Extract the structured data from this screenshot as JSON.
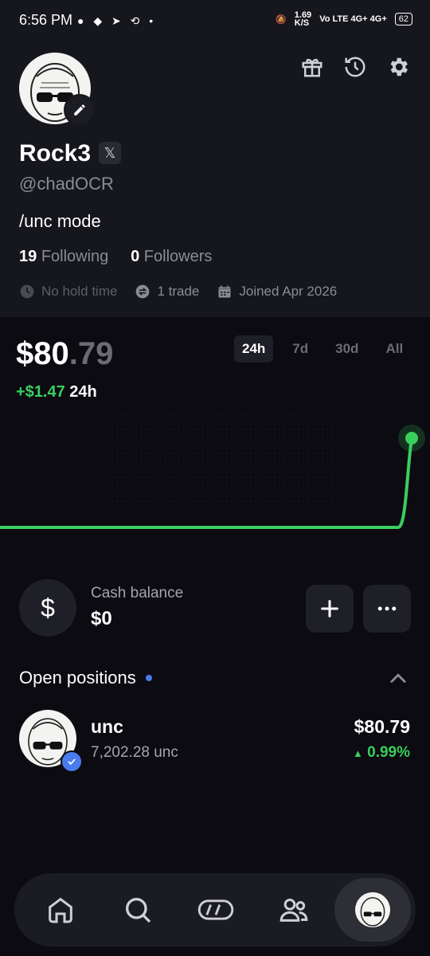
{
  "status_bar": {
    "time": "6:56 PM",
    "network_speed": "1.69\nK/S",
    "signal": "Vo LTE  4G+  4G+",
    "battery": "62"
  },
  "profile": {
    "name": "Rock3",
    "x_badge": "𝕏",
    "handle": "@chadOCR",
    "bio": "/unc mode",
    "following_count": "19",
    "following_label": "Following",
    "followers_count": "0",
    "followers_label": "Followers",
    "hold_time": "No hold time",
    "trades": "1 trade",
    "joined": "Joined Apr 2026"
  },
  "portfolio": {
    "value_main": "$80",
    "value_cents": ".79",
    "change_amount": "+$1.47",
    "change_period": "24h",
    "ranges": [
      "24h",
      "7d",
      "30d",
      "All"
    ],
    "active_range": "24h"
  },
  "chart_data": {
    "type": "line",
    "title": "",
    "series": [
      {
        "values": [
          79.32,
          79.32,
          79.32,
          79.32,
          79.32,
          79.32,
          79.32,
          79.32,
          79.32,
          80.79
        ]
      }
    ],
    "line_color": "#3bce5d"
  },
  "cash": {
    "icon": "$",
    "label": "Cash balance",
    "value": "$0",
    "add_icon": "plus-icon",
    "more_icon": "more-icon"
  },
  "positions": {
    "title": "Open positions",
    "items": [
      {
        "name": "unc",
        "amount": "7,202.28 unc",
        "value": "$80.79",
        "change": "0.99%"
      }
    ]
  },
  "colors": {
    "positive": "#3bce5d",
    "accent_blue": "#4a7cf0",
    "background": "#0b0b11",
    "panel": "#16161d"
  },
  "nav": {
    "items": [
      "home-icon",
      "search-icon",
      "coins-icon",
      "people-icon",
      "profile-avatar"
    ]
  }
}
